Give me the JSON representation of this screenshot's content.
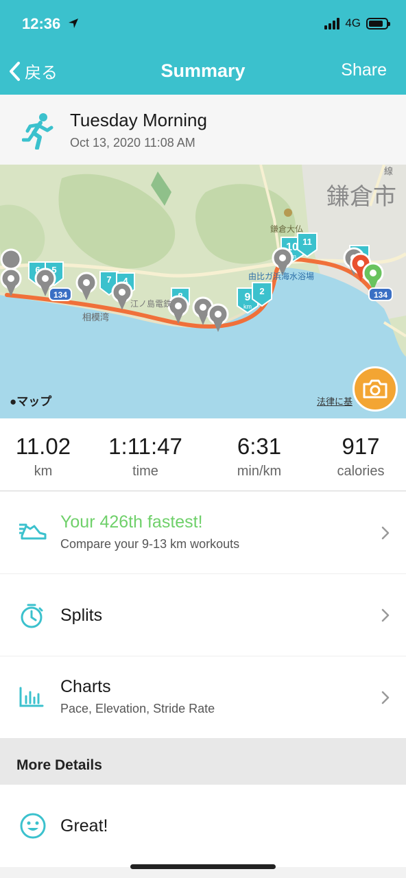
{
  "status": {
    "time": "12:36",
    "network": "4G"
  },
  "nav": {
    "back_label": "戻る",
    "title": "Summary",
    "share_label": "Share"
  },
  "activity": {
    "title": "Tuesday Morning",
    "datetime": "Oct 13, 2020 11:08 AM"
  },
  "map": {
    "logo_text": "マップ",
    "legal_text": "法律に基",
    "place_labels": [
      "鎌倉市",
      "鎌倉大仏",
      "由比ガ浜海水浴場",
      "相模湾",
      "江ノ島電鉄",
      "線"
    ],
    "road_badges": [
      "134",
      "134"
    ],
    "km_markers": [
      "6",
      "5",
      "7",
      "4",
      "8",
      "9",
      "10",
      "11",
      "2",
      "1"
    ],
    "marker_unit": "km",
    "colors": {
      "route": "#f0703a",
      "marker": "#3bc1cd",
      "sea": "#a6d8ea",
      "land": "#d9e4c4",
      "start": "#69c35e",
      "end": "#e9502f"
    }
  },
  "stats": [
    {
      "value": "11.02",
      "unit": "km"
    },
    {
      "value": "1:11:47",
      "unit": "time"
    },
    {
      "value": "6:31",
      "unit": "min/km"
    },
    {
      "value": "917",
      "unit": "calories"
    }
  ],
  "rows": {
    "fastest": {
      "title": "Your 426th fastest!",
      "subtitle": "Compare your 9-13 km workouts"
    },
    "splits": {
      "title": "Splits"
    },
    "charts": {
      "title": "Charts",
      "subtitle": "Pace, Elevation, Stride Rate"
    }
  },
  "section": {
    "more_details": "More Details"
  },
  "mood": {
    "label": "Great!"
  },
  "colors": {
    "accent": "#3bc1cd",
    "highlight": "#6fd06a",
    "camera": "#f3a533"
  }
}
